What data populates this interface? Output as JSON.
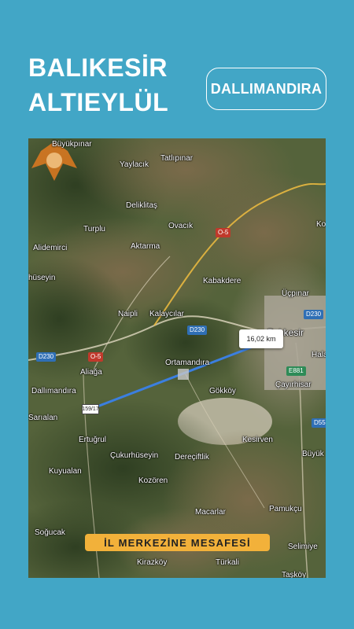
{
  "header": {
    "title_line1": "BALIKESİR",
    "title_line2": "ALTIEYLÜL",
    "location_badge": "DALLIMANDIRA"
  },
  "map": {
    "distance_label": "16,02 km",
    "pin_label": "159/17",
    "caption": "İL MERKEZİNE MESAFESİ",
    "places": {
      "buyukpinar": "Büyükpınar",
      "yaylacik": "Yaylacık",
      "tatlipinar": "Tatlıpınar",
      "deliklitas": "Deliklitaş",
      "ovacik": "Ovacık",
      "turplu": "Turplu",
      "alidemirci": "Alidemirci",
      "aktarma": "Aktarma",
      "husseyin": "hüseyin",
      "kabakdere": "Kabakdere",
      "ucpinar": "Üçpınar",
      "naipli": "Naipli",
      "kalaycilar": "Kalaycılar",
      "balikesir": "Balıkesir",
      "hala": "Hala",
      "aliaga": "Aliağa",
      "ortamandira": "Ortamandıra",
      "cayirhisar": "Çayırhisar",
      "dallimandira": "Dallımandıra",
      "gokkoy": "Gökköy",
      "sarialan": "Sarıalan",
      "ertugrul": "Ertuğrul",
      "kesirven": "Kesirven",
      "cukurhuseyin": "Çukurhüseyin",
      "dereciftlik": "Dereçiftlik",
      "buyuk": "Büyük",
      "kuyualan": "Kuyualan",
      "kozoren": "Kozören",
      "macarlar": "Macarlar",
      "pamukcu": "Pamukçu",
      "sogucak": "Soğucak",
      "selimiye": "Selimiye",
      "kirazkoy": "Kirazköy",
      "turkali": "Türkali",
      "ko": "Ko",
      "taskoy": "Taşköy"
    },
    "roads": {
      "o5_north": "O-5",
      "o5_west": "O-5",
      "d230_west": "D230",
      "d230_center": "D230",
      "d230_east": "D230",
      "e881": "E881",
      "d55": "D55"
    },
    "colors": {
      "route_line": "#3b7fe0",
      "caption_bg": "#f2b13a",
      "page_bg": "#42a6c6"
    }
  }
}
